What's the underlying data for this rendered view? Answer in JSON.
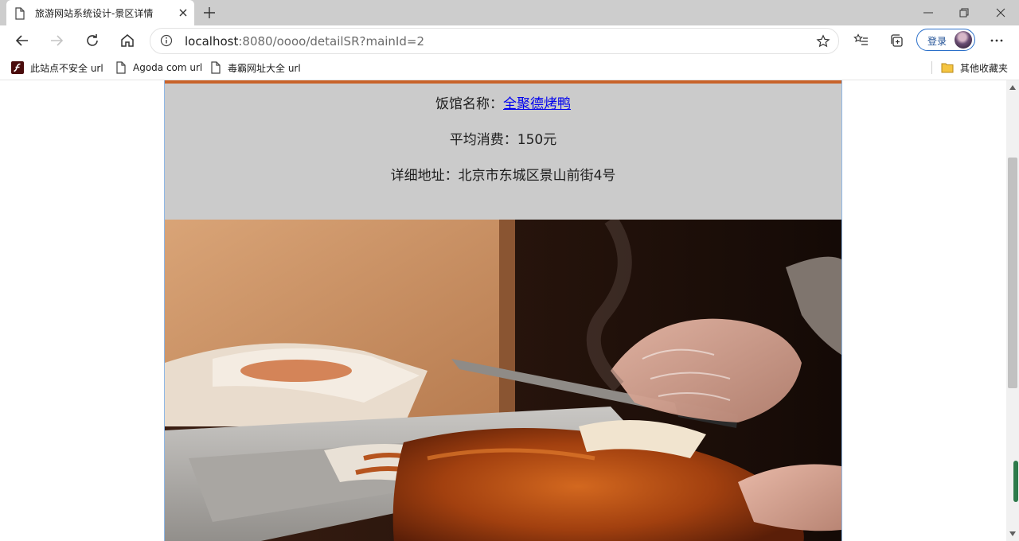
{
  "browser": {
    "tab": {
      "title": "旅游网站系统设计-景区详情"
    },
    "address_bar": {
      "host": "localhost",
      "rest": ":8080/oooo/detailSR?mainId=2"
    },
    "login_label": "登录",
    "bookmarks": [
      {
        "label": "此站点不安全 url",
        "icon": "flash-icon"
      },
      {
        "label": "Agoda com url",
        "icon": "page-icon"
      },
      {
        "label": "毒霸网址大全 url",
        "icon": "page-icon"
      }
    ],
    "other_bookmarks_label": "其他收藏夹"
  },
  "page": {
    "restaurant": {
      "name_label": "饭馆名称：",
      "name": "全聚德烤鸭",
      "price_label": "平均消费：150元",
      "address_label": "详细地址：北京市东城区景山前街4号"
    },
    "photo": {
      "subject": "roast-duck-photo"
    }
  },
  "colors": {
    "accent_bar": "#c8632a",
    "content_bg": "#cbcbcb",
    "link": "#0000ee",
    "login_border": "#2a6fc9"
  }
}
